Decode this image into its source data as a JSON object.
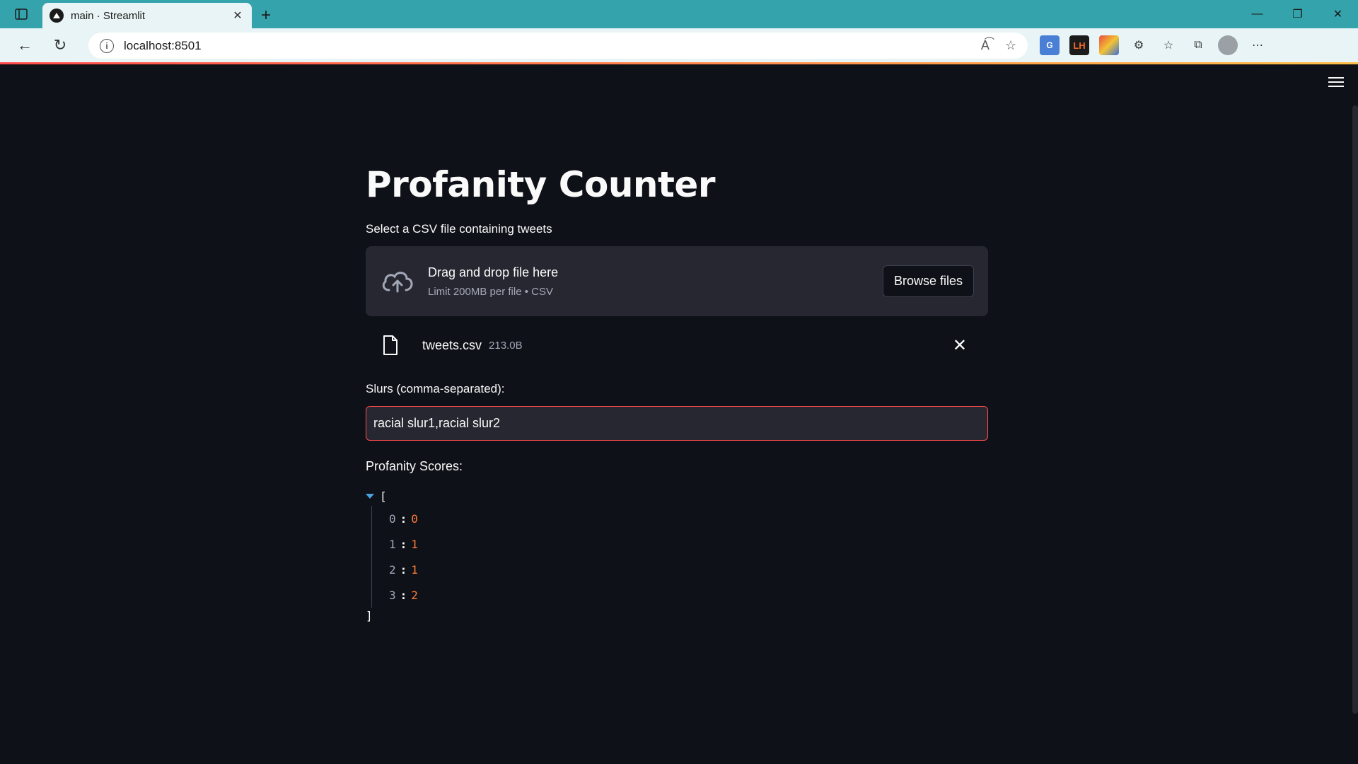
{
  "browser": {
    "tab_title": "main · Streamlit",
    "url": "localhost:8501"
  },
  "app": {
    "title": "Profanity Counter",
    "uploader": {
      "label": "Select a CSV file containing tweets",
      "drop_text": "Drag and drop file here",
      "limit_text": "Limit 200MB per file • CSV",
      "browse_label": "Browse files"
    },
    "uploaded_file": {
      "name": "tweets.csv",
      "size": "213.0B"
    },
    "slurs": {
      "label": "Slurs (comma-separated):",
      "value": "racial slur1,racial slur2"
    },
    "scores": {
      "label": "Profanity Scores:",
      "open_bracket": "[",
      "close_bracket": "]",
      "items": [
        {
          "key": "0",
          "value": "0"
        },
        {
          "key": "1",
          "value": "1"
        },
        {
          "key": "2",
          "value": "1"
        },
        {
          "key": "3",
          "value": "2"
        }
      ]
    }
  },
  "colors": {
    "background": "#0e1117",
    "secondary_background": "#262730",
    "error_border": "#ff4b4b",
    "json_value": "#ff7b39",
    "browser_accent": "#35a3ab"
  }
}
